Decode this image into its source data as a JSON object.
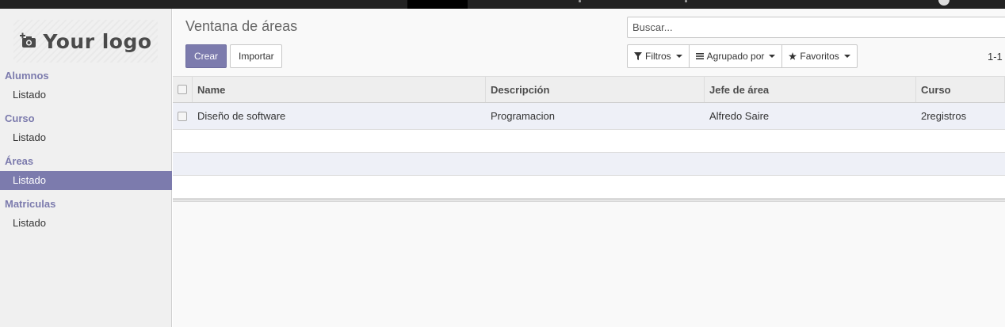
{
  "logo": {
    "text": "Your logo"
  },
  "sidebar": {
    "sections": [
      {
        "header": "Alumnos",
        "items": [
          {
            "label": "Listado",
            "active": false
          }
        ]
      },
      {
        "header": "Curso",
        "items": [
          {
            "label": "Listado",
            "active": false
          }
        ]
      },
      {
        "header": "Áreas",
        "items": [
          {
            "label": "Listado",
            "active": true
          }
        ]
      },
      {
        "header": "Matriculas",
        "items": [
          {
            "label": "Listado",
            "active": false
          }
        ]
      }
    ]
  },
  "control_panel": {
    "breadcrumb": "Ventana de áreas",
    "create_label": "Crear",
    "import_label": "Importar",
    "search_placeholder": "Buscar...",
    "filters_label": "Filtros",
    "group_by_label": "Agrupado por",
    "favorites_label": "Favoritos",
    "pager": "1-1"
  },
  "table": {
    "columns": [
      "Name",
      "Descripción",
      "Jefe de área",
      "Curso"
    ],
    "rows": [
      [
        "Diseño de software",
        "Programacion",
        "Alfredo Saire",
        "2registros"
      ]
    ]
  },
  "colors": {
    "accent": "#7c7bad",
    "topbar": "#222222"
  },
  "icons": [
    "camera-plus-icon",
    "filter-icon",
    "bars-icon",
    "star-icon",
    "caret-down-icon"
  ]
}
